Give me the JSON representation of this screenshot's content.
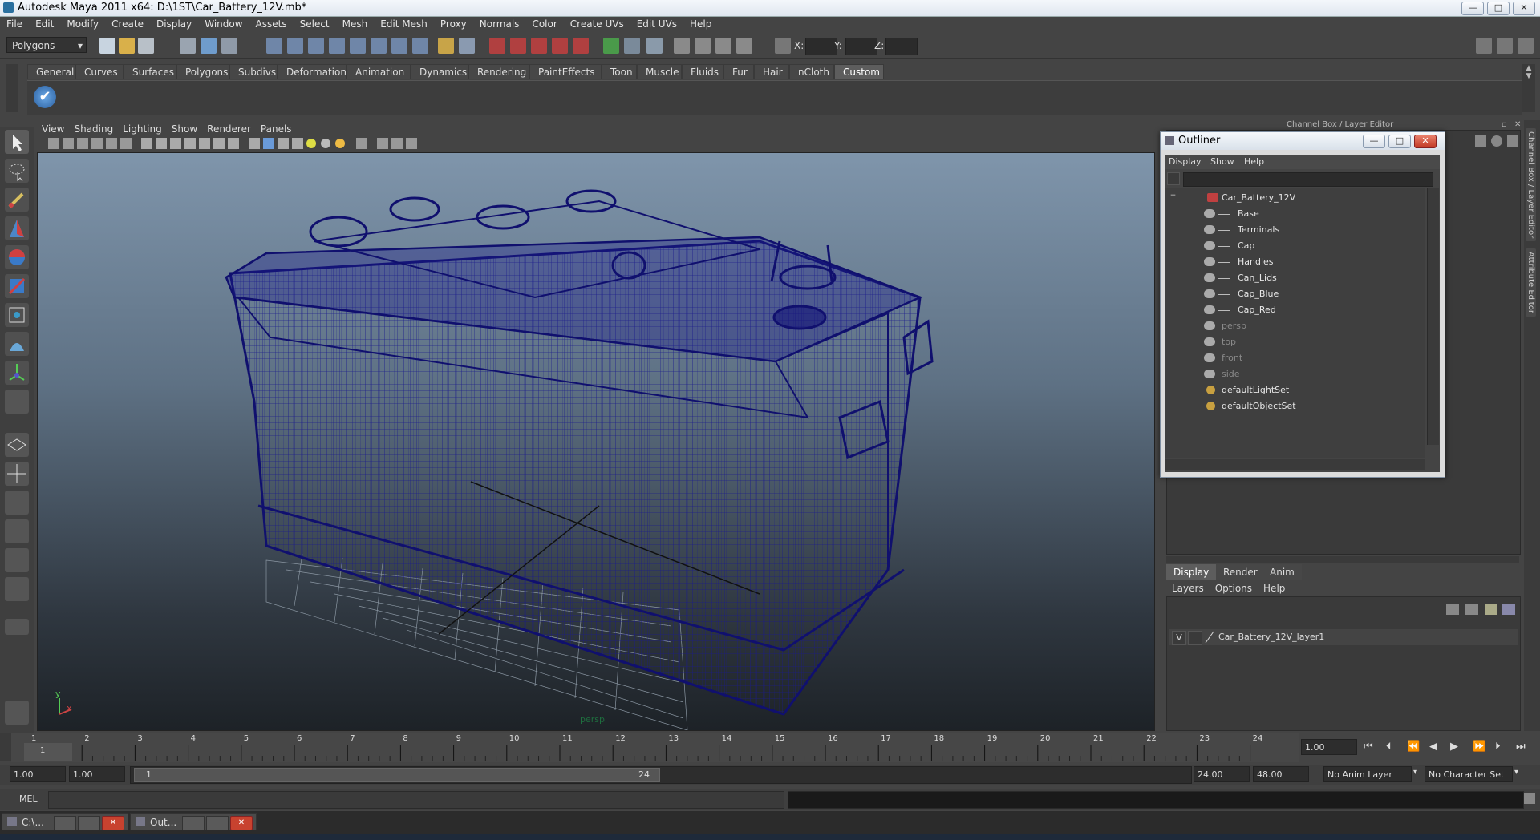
{
  "window": {
    "title": "Autodesk Maya 2011 x64: D:\\1ST\\Car_Battery_12V.mb*"
  },
  "menubar": [
    "File",
    "Edit",
    "Modify",
    "Create",
    "Display",
    "Window",
    "Assets",
    "Select",
    "Mesh",
    "Edit Mesh",
    "Proxy",
    "Normals",
    "Color",
    "Create UVs",
    "Edit UVs",
    "Help"
  ],
  "status": {
    "mode": "Polygons",
    "x_label": "X:",
    "y_label": "Y:",
    "z_label": "Z:"
  },
  "shelf": {
    "tabs": [
      "General",
      "Curves",
      "Surfaces",
      "Polygons",
      "Subdivs",
      "Deformation",
      "Animation",
      "Dynamics",
      "Rendering",
      "PaintEffects",
      "Toon",
      "Muscle",
      "Fluids",
      "Fur",
      "Hair",
      "nCloth",
      "Custom"
    ],
    "active": "Custom"
  },
  "viewport": {
    "menu": [
      "View",
      "Shading",
      "Lighting",
      "Show",
      "Renderer",
      "Panels"
    ],
    "camera_label": "persp",
    "axis_y": "y",
    "axis_x": "x",
    "wire_color": "#1a1a8c"
  },
  "channel_box": {
    "title": "Channel Box / Layer Editor",
    "side_tab_1": "Channel Box / Layer Editor",
    "side_tab_2": "Attribute Editor"
  },
  "outliner": {
    "title": "Outliner",
    "menu": [
      "Display",
      "Show",
      "Help"
    ],
    "items": [
      {
        "label": "Car_Battery_12V",
        "level": 0,
        "dim": false
      },
      {
        "label": "Base",
        "level": 1,
        "dim": false
      },
      {
        "label": "Terminals",
        "level": 1,
        "dim": false
      },
      {
        "label": "Cap",
        "level": 1,
        "dim": false
      },
      {
        "label": "Handles",
        "level": 1,
        "dim": false
      },
      {
        "label": "Can_Lids",
        "level": 1,
        "dim": false
      },
      {
        "label": "Cap_Blue",
        "level": 1,
        "dim": false
      },
      {
        "label": "Cap_Red",
        "level": 1,
        "dim": false
      },
      {
        "label": "persp",
        "level": 0,
        "dim": true
      },
      {
        "label": "top",
        "level": 0,
        "dim": true
      },
      {
        "label": "front",
        "level": 0,
        "dim": true
      },
      {
        "label": "side",
        "level": 0,
        "dim": true
      },
      {
        "label": "defaultLightSet",
        "level": 0,
        "dim": false
      },
      {
        "label": "defaultObjectSet",
        "level": 0,
        "dim": false
      }
    ]
  },
  "layer_editor": {
    "tabs": [
      "Display",
      "Render",
      "Anim"
    ],
    "active": "Display",
    "menu": [
      "Layers",
      "Options",
      "Help"
    ],
    "layer": {
      "visible": "V",
      "name": "Car_Battery_12V_layer1"
    }
  },
  "timeline": {
    "ticks": [
      "1",
      "2",
      "3",
      "4",
      "5",
      "6",
      "7",
      "8",
      "9",
      "10",
      "11",
      "12",
      "13",
      "14",
      "15",
      "16",
      "17",
      "18",
      "19",
      "20",
      "21",
      "22",
      "23",
      "24"
    ],
    "current_frame_marker": "1",
    "current_time": "1.00"
  },
  "range": {
    "start": "1.00",
    "start2": "1.00",
    "slider_start": "1",
    "slider_end": "24",
    "end": "24.00",
    "end2": "48.00",
    "anim_layer": "No Anim Layer",
    "character_set": "No Character Set"
  },
  "command": {
    "label": "MEL"
  },
  "taskbar": [
    {
      "label": "C:\\..."
    },
    {
      "label": "Out..."
    }
  ]
}
